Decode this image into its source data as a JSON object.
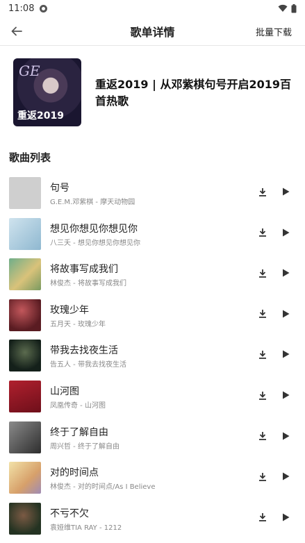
{
  "status_bar": {
    "time": "11:08"
  },
  "app_bar": {
    "title": "歌单详情",
    "batch_download": "批量下载"
  },
  "playlist": {
    "title": "重返2019 | 从邓紫棋句号开启2019百首热歌",
    "cover_text": "重返2019"
  },
  "section_title": "歌曲列表",
  "songs": [
    {
      "name": "句号",
      "meta": "G.E.M.邓紫棋 - 摩天动物园"
    },
    {
      "name": "想见你想见你想见你",
      "meta": "八三夭 - 想见你想见你想见你"
    },
    {
      "name": "将故事写成我们",
      "meta": "林俊杰 - 将故事写成我们"
    },
    {
      "name": "玫瑰少年",
      "meta": "五月天 - 玫瑰少年"
    },
    {
      "name": "带我去找夜生活",
      "meta": "告五人 - 带我去找夜生活"
    },
    {
      "name": "山河图",
      "meta": "凤凰传奇 - 山河图"
    },
    {
      "name": "终于了解自由",
      "meta": "周兴哲 - 终于了解自由"
    },
    {
      "name": "对的时间点",
      "meta": "林俊杰 - 对的时间点/As I Believe"
    },
    {
      "name": "不亏不欠",
      "meta": "袁娅维TIA RAY - 1212"
    }
  ],
  "thumb_colors": [
    "#cfcfcf",
    "#9fc4da",
    "#c9b679",
    "#7a2c30",
    "#2a3a2e",
    "#8d1a26",
    "#4c4c4c",
    "#d9b78a",
    "#3d5a3a"
  ]
}
